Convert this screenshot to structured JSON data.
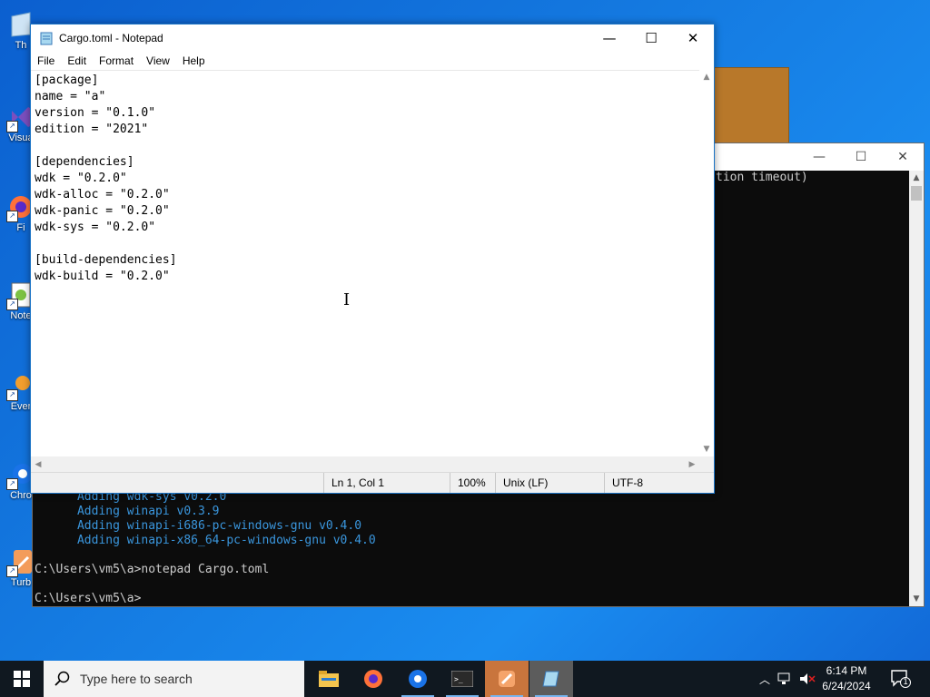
{
  "desktop": {
    "icons": [
      {
        "label": "Th",
        "icon": "recycle-bin-icon"
      },
      {
        "label": "Visua",
        "label2": "2",
        "icon": "visual-studio-icon"
      },
      {
        "label": "Fi",
        "icon": "firefox-icon"
      },
      {
        "label": "Note",
        "icon": "notepadpp-icon"
      },
      {
        "label": "Ever",
        "icon": "everything-icon"
      },
      {
        "label": "Chro",
        "icon": "chrome-icon"
      },
      {
        "label": "Turb",
        "icon": "turbo-icon"
      }
    ]
  },
  "terminal": {
    "visible_partial": "tion timeout)",
    "lines": [
      {
        "text": "      Adding wdk-sys v0.2.0",
        "style": "green"
      },
      {
        "text": "      Adding winapi v0.3.9",
        "style": "green"
      },
      {
        "text": "      Adding winapi-i686-pc-windows-gnu v0.4.0",
        "style": "green"
      },
      {
        "text": "      Adding winapi-x86_64-pc-windows-gnu v0.4.0",
        "style": "green"
      },
      {
        "text": "",
        "style": "plain"
      },
      {
        "text": "C:\\Users\\vm5\\a>notepad Cargo.toml",
        "style": "plain"
      },
      {
        "text": "",
        "style": "plain"
      },
      {
        "text": "C:\\Users\\vm5\\a>",
        "style": "plain"
      }
    ]
  },
  "notepad": {
    "title": "Cargo.toml - Notepad",
    "menu": [
      "File",
      "Edit",
      "Format",
      "View",
      "Help"
    ],
    "content": "[package]\nname = \"a\"\nversion = \"0.1.0\"\nedition = \"2021\"\n\n[dependencies]\nwdk = \"0.2.0\"\nwdk-alloc = \"0.2.0\"\nwdk-panic = \"0.2.0\"\nwdk-sys = \"0.2.0\"\n\n[build-dependencies]\nwdk-build = \"0.2.0\"",
    "status": {
      "position": "Ln 1, Col 1",
      "zoom": "100%",
      "line_ending": "Unix (LF)",
      "encoding": "UTF-8"
    }
  },
  "taskbar": {
    "search_placeholder": "Type here to search",
    "apps": [
      "file-explorer-icon",
      "firefox-icon",
      "chrome-icon",
      "terminal-icon",
      "turbo-icon",
      "notepad-icon"
    ],
    "clock_time": "6:14 PM",
    "clock_date": "6/24/2024",
    "notification_count": "1"
  }
}
